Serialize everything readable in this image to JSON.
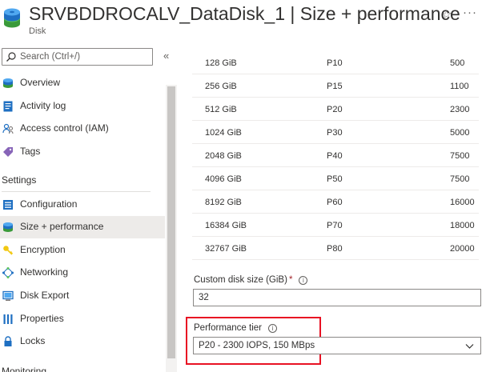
{
  "header": {
    "title": "SRVBDDROCALV_DataDisk_1 | Size + performance",
    "subtitle": "Disk",
    "star_icon": "star-icon",
    "more_icon": "more-icon"
  },
  "sidebar": {
    "search_placeholder": "Search (Ctrl+/)",
    "collapse_icon": "double-chevron-left-icon",
    "items": [
      {
        "label": "Overview",
        "icon": "disk-icon"
      },
      {
        "label": "Activity log",
        "icon": "activity-log-icon"
      },
      {
        "label": "Access control (IAM)",
        "icon": "people-icon"
      },
      {
        "label": "Tags",
        "icon": "tag-icon"
      }
    ],
    "settings_section": "Settings",
    "settings_items": [
      {
        "label": "Configuration",
        "icon": "configuration-icon"
      },
      {
        "label": "Size + performance",
        "icon": "disk-icon",
        "selected": true
      },
      {
        "label": "Encryption",
        "icon": "key-icon"
      },
      {
        "label": "Networking",
        "icon": "network-icon"
      },
      {
        "label": "Disk Export",
        "icon": "export-icon"
      },
      {
        "label": "Properties",
        "icon": "properties-icon"
      },
      {
        "label": "Locks",
        "icon": "lock-icon"
      }
    ],
    "monitoring_section": "Monitoring"
  },
  "tiers": [
    {
      "size": "128 GiB",
      "tier": "P10",
      "iops": "500"
    },
    {
      "size": "256 GiB",
      "tier": "P15",
      "iops": "1100"
    },
    {
      "size": "512 GiB",
      "tier": "P20",
      "iops": "2300"
    },
    {
      "size": "1024 GiB",
      "tier": "P30",
      "iops": "5000"
    },
    {
      "size": "2048 GiB",
      "tier": "P40",
      "iops": "7500"
    },
    {
      "size": "4096 GiB",
      "tier": "P50",
      "iops": "7500"
    },
    {
      "size": "8192 GiB",
      "tier": "P60",
      "iops": "16000"
    },
    {
      "size": "16384 GiB",
      "tier": "P70",
      "iops": "18000"
    },
    {
      "size": "32767 GiB",
      "tier": "P80",
      "iops": "20000"
    }
  ],
  "custom_size": {
    "label": "Custom disk size (GiB)",
    "required": "*",
    "value": "32"
  },
  "performance_tier": {
    "label": "Performance tier",
    "value": "P20 - 2300 IOPS, 150 MBps"
  },
  "colors": {
    "accent": "#0078d4",
    "highlight_border": "#e81123",
    "selected_bg": "#edebe9"
  }
}
